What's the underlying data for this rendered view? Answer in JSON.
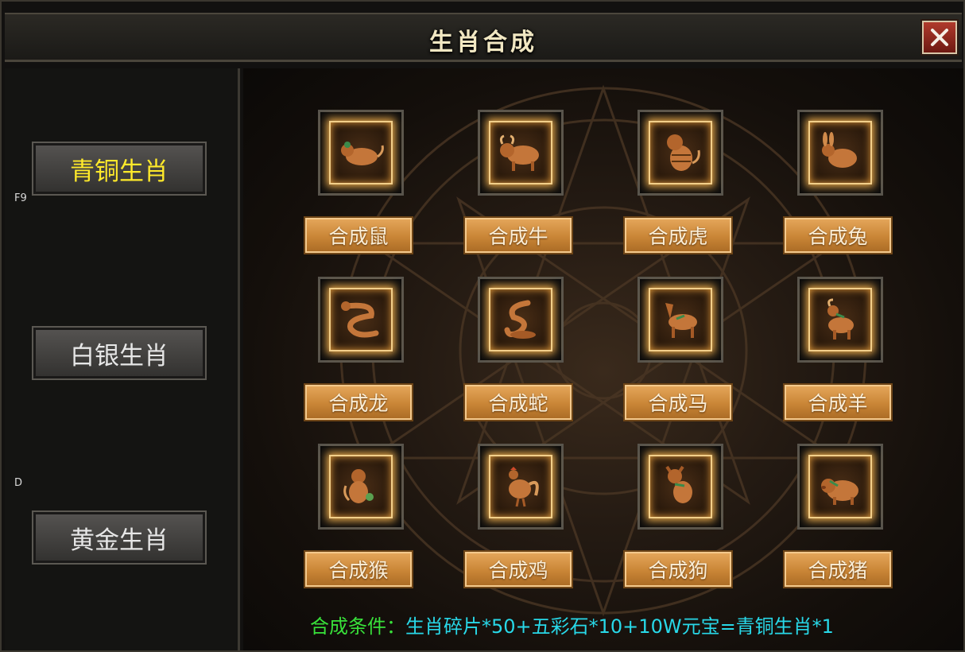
{
  "window": {
    "title": "生肖合成",
    "close_icon": "close-icon"
  },
  "sidebar": {
    "tabs": [
      {
        "label": "青铜生肖",
        "active": true
      },
      {
        "label": "白银生肖",
        "active": false
      },
      {
        "label": "黄金生肖",
        "active": false
      }
    ],
    "hotkeys": [
      "F9",
      "D"
    ]
  },
  "zodiac": {
    "items": [
      {
        "icon": "rat-icon",
        "button": "合成鼠"
      },
      {
        "icon": "ox-icon",
        "button": "合成牛"
      },
      {
        "icon": "tiger-icon",
        "button": "合成虎"
      },
      {
        "icon": "rabbit-icon",
        "button": "合成兔"
      },
      {
        "icon": "dragon-icon",
        "button": "合成龙"
      },
      {
        "icon": "snake-icon",
        "button": "合成蛇"
      },
      {
        "icon": "horse-icon",
        "button": "合成马"
      },
      {
        "icon": "goat-icon",
        "button": "合成羊"
      },
      {
        "icon": "monkey-icon",
        "button": "合成猴"
      },
      {
        "icon": "rooster-icon",
        "button": "合成鸡"
      },
      {
        "icon": "dog-icon",
        "button": "合成狗"
      },
      {
        "icon": "pig-icon",
        "button": "合成猪"
      }
    ]
  },
  "condition": {
    "label": "合成条件：",
    "value": "生肖碎片*50+五彩石*10+10W元宝=青铜生肖*1"
  },
  "colors": {
    "active_tab": "#ffea2a",
    "condition_label": "#38e03a",
    "condition_value": "#28d8e8",
    "craft_button": "#c98536"
  }
}
